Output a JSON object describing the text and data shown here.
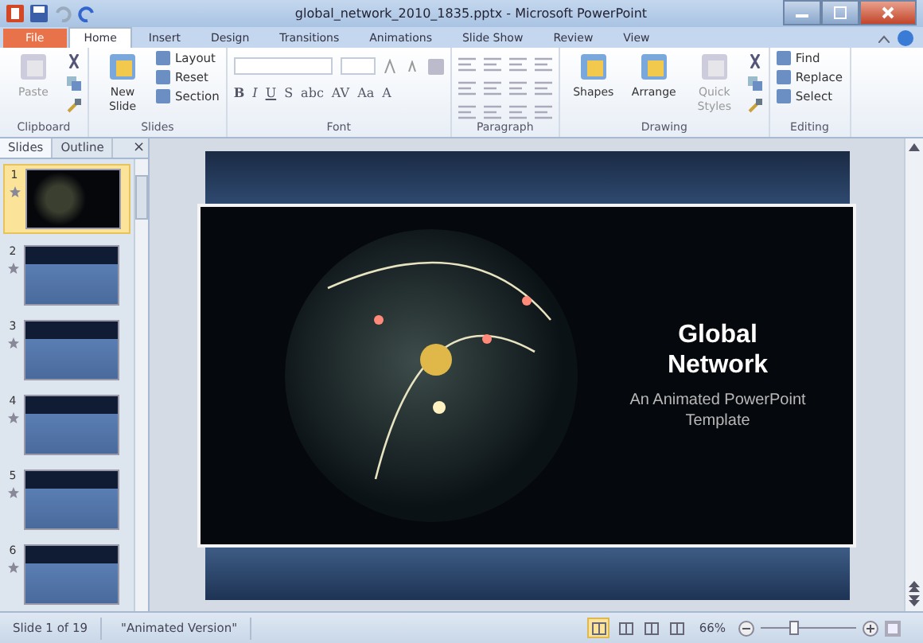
{
  "window": {
    "title": "global_network_2010_1835.pptx - Microsoft PowerPoint"
  },
  "tabs": [
    {
      "label": "File",
      "kind": "file",
      "selected": false
    },
    {
      "label": "Home",
      "kind": "tab",
      "selected": true
    },
    {
      "label": "Insert",
      "kind": "tab",
      "selected": false
    },
    {
      "label": "Design",
      "kind": "tab",
      "selected": false
    },
    {
      "label": "Transitions",
      "kind": "tab",
      "selected": false
    },
    {
      "label": "Animations",
      "kind": "tab",
      "selected": false
    },
    {
      "label": "Slide Show",
      "kind": "tab",
      "selected": false
    },
    {
      "label": "Review",
      "kind": "tab",
      "selected": false
    },
    {
      "label": "View",
      "kind": "tab",
      "selected": false
    }
  ],
  "ribbon": [
    {
      "label": "Clipboard",
      "items": [
        {
          "kind": "large",
          "label": "Paste",
          "disabled": true
        },
        {
          "kind": "icons"
        }
      ]
    },
    {
      "label": "Slides",
      "items": [
        {
          "kind": "large",
          "label": "New Slide",
          "disabled": false
        },
        {
          "kind": "small",
          "labels": [
            "Layout",
            "Reset",
            "Section"
          ]
        }
      ]
    },
    {
      "label": "Font",
      "items": [
        {
          "kind": "font",
          "glyphs": [
            "B",
            "I",
            "U",
            "S",
            "abc",
            "AV",
            "Aa",
            "A"
          ]
        }
      ]
    },
    {
      "label": "Paragraph",
      "items": [
        {
          "kind": "para"
        }
      ]
    },
    {
      "label": "Drawing",
      "items": [
        {
          "kind": "large",
          "label": "Shapes",
          "disabled": false
        },
        {
          "kind": "large",
          "label": "Arrange",
          "disabled": false
        },
        {
          "kind": "large",
          "label": "Quick Styles",
          "disabled": true
        },
        {
          "kind": "icons"
        }
      ]
    },
    {
      "label": "Editing",
      "items": [
        {
          "kind": "small",
          "labels": [
            "Find",
            "Replace",
            "Select"
          ]
        }
      ]
    }
  ],
  "panel": {
    "tabs": [
      {
        "label": "Slides",
        "selected": true
      },
      {
        "label": "Outline",
        "selected": false
      }
    ],
    "close": "×",
    "thumbnails": [
      {
        "number": "1",
        "selected": true
      },
      {
        "number": "2",
        "selected": false
      },
      {
        "number": "3",
        "selected": false
      },
      {
        "number": "4",
        "selected": false
      },
      {
        "number": "5",
        "selected": false
      },
      {
        "number": "6",
        "selected": false
      }
    ]
  },
  "slide": {
    "title": "Global Network",
    "subtitle": "An Animated PowerPoint Template"
  },
  "status_bar": {
    "slide": "Slide 1 of 19",
    "theme": "\"Animated Version\"",
    "views": [
      {
        "selected": true
      },
      {
        "selected": false
      },
      {
        "selected": false
      },
      {
        "selected": false
      }
    ],
    "zoom": "66%",
    "zoom_level": {
      "level": 0.35
    }
  }
}
